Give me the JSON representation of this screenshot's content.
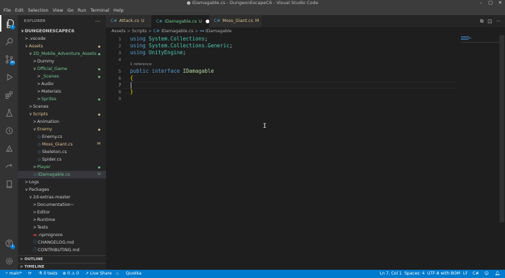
{
  "window": {
    "title": "● IDamagable.cs - DungeonEscapeC6 - Visual Studio Code",
    "menu": [
      "File",
      "Edit",
      "Selection",
      "View",
      "Go",
      "Run",
      "Terminal",
      "Help"
    ],
    "controls": {
      "minimize": "–",
      "maximize": "▢",
      "close": "✕"
    }
  },
  "activity_bar": {
    "items": [
      {
        "name": "explorer-icon",
        "badge": "1"
      },
      {
        "name": "search-icon"
      },
      {
        "name": "source-control-icon",
        "badge": "40"
      },
      {
        "name": "run-debug-icon"
      },
      {
        "name": "extensions-icon"
      },
      {
        "name": "testing-icon"
      },
      {
        "name": "timeline-icon"
      },
      {
        "name": "azure-icon"
      },
      {
        "name": "live-share-icon"
      },
      {
        "name": "notebook-icon"
      }
    ],
    "bottom": [
      {
        "name": "accounts-icon",
        "badge": "1"
      },
      {
        "name": "manage-gear-icon"
      }
    ]
  },
  "sidebar": {
    "title": "EXPLORER",
    "more": "···",
    "tree": [
      {
        "label": "DUNGEONESCAPEC6",
        "chevron": "∨",
        "indent": 0,
        "type": "root"
      },
      {
        "label": ".vscode",
        "chevron": ">",
        "indent": 1
      },
      {
        "label": "Assets",
        "chevron": "∨",
        "indent": 1,
        "status": "dot",
        "color": "modified"
      },
      {
        "label": "2D_Mobile_Adventure_Assets",
        "chevron": "∨",
        "indent": 2,
        "status": "dot",
        "color": "untracked"
      },
      {
        "label": "Dummy",
        "chevron": ">",
        "indent": 3
      },
      {
        "label": "Official_Game",
        "chevron": "∨",
        "indent": 3,
        "status": "dot",
        "color": "untracked"
      },
      {
        "label": "_Scenes",
        "chevron": ">",
        "indent": 4,
        "status": "dot",
        "color": "untracked"
      },
      {
        "label": "Audio",
        "chevron": ">",
        "indent": 4
      },
      {
        "label": "Materials",
        "chevron": ">",
        "indent": 4
      },
      {
        "label": "Sprites",
        "chevron": ">",
        "indent": 4,
        "status": "dot",
        "color": "untracked"
      },
      {
        "label": "Scenes",
        "chevron": ">",
        "indent": 2
      },
      {
        "label": "Scripts",
        "chevron": "∨",
        "indent": 2,
        "status": "dot",
        "color": "modified"
      },
      {
        "label": "Animation",
        "chevron": ">",
        "indent": 3
      },
      {
        "label": "Enemy",
        "chevron": "∨",
        "indent": 3,
        "status": "dot",
        "color": "modified"
      },
      {
        "label": "Enemy.cs",
        "file": "C#",
        "indent": 4
      },
      {
        "label": "Moss_Giant.cs",
        "file": "C#",
        "indent": 4,
        "status": "M",
        "color": "modified"
      },
      {
        "label": "Skeleton.cs",
        "file": "C#",
        "indent": 4
      },
      {
        "label": "Spider.cs",
        "file": "C#",
        "indent": 4
      },
      {
        "label": "Player",
        "chevron": ">",
        "indent": 3,
        "status": "dot",
        "color": "untracked"
      },
      {
        "label": "IDamagable.cs",
        "file": "C#",
        "indent": 3,
        "status": "U",
        "color": "untracked",
        "selected": true
      },
      {
        "label": "Logs",
        "chevron": ">",
        "indent": 1
      },
      {
        "label": "Packages",
        "chevron": "∨",
        "indent": 1
      },
      {
        "label": "2d-extras-master",
        "chevron": "∨",
        "indent": 2
      },
      {
        "label": "Documentation~",
        "chevron": ">",
        "indent": 3
      },
      {
        "label": "Editor",
        "chevron": ">",
        "indent": 3
      },
      {
        "label": "Runtime",
        "chevron": ">",
        "indent": 3
      },
      {
        "label": "Tests",
        "chevron": ">",
        "indent": 3
      },
      {
        "label": ".npmignore",
        "file": "npm",
        "indent": 3
      },
      {
        "label": "CHANGELOG.md",
        "file": "info",
        "indent": 3
      },
      {
        "label": "CONTRIBUTING.md",
        "file": "info",
        "indent": 3
      }
    ],
    "sections": [
      {
        "label": "OUTLINE",
        "chevron": ">"
      },
      {
        "label": "TIMELINE",
        "chevron": ">"
      }
    ]
  },
  "tabs": [
    {
      "label": "Attack.cs",
      "status": "U",
      "active": false,
      "dirty": false
    },
    {
      "label": "IDamagable.cs",
      "status": "U",
      "active": true,
      "dirty": true
    },
    {
      "label": "Moss_Giant.cs",
      "status": "M",
      "active": false,
      "dirty": false
    }
  ],
  "editor_actions": [
    "split-compare-icon",
    "split-editor-icon",
    "more-actions-icon"
  ],
  "breadcrumbs": [
    "Assets",
    "Scripts",
    "IDamagable.cs",
    "IDamagable"
  ],
  "editor": {
    "codelens": "1 reference",
    "lines": [
      {
        "n": "1",
        "tokens": [
          {
            "t": "using ",
            "c": "kw"
          },
          {
            "t": "System.Collections",
            "c": "ns"
          },
          {
            "t": ";",
            "c": "punct"
          }
        ]
      },
      {
        "n": "2",
        "tokens": [
          {
            "t": "using ",
            "c": "kw"
          },
          {
            "t": "System.Collections.Generic",
            "c": "ns"
          },
          {
            "t": ";",
            "c": "punct"
          }
        ]
      },
      {
        "n": "3",
        "tokens": [
          {
            "t": "using ",
            "c": "kw"
          },
          {
            "t": "UnityEngine",
            "c": "ns"
          },
          {
            "t": ";",
            "c": "punct"
          }
        ]
      },
      {
        "n": "4",
        "tokens": []
      },
      {
        "n": "5",
        "tokens": [
          {
            "t": "public ",
            "c": "kw"
          },
          {
            "t": "interface ",
            "c": "kw"
          },
          {
            "t": "IDamagable",
            "c": "typename"
          }
        ]
      },
      {
        "n": "6",
        "tokens": [
          {
            "t": "{",
            "c": "brace"
          }
        ]
      },
      {
        "n": "7",
        "tokens": []
      },
      {
        "n": "8",
        "tokens": [
          {
            "t": "}",
            "c": "brace"
          }
        ]
      },
      {
        "n": "9",
        "tokens": []
      }
    ],
    "current_line": 7
  },
  "statusbar": {
    "branch": "main*",
    "sync": "sync-icon",
    "tests": "0 tests",
    "errors": "0",
    "warnings": "0",
    "live_share": "Live Share",
    "quokka": "Quokka",
    "position": "Ln 7, Col 1",
    "spaces": "Spaces: 4",
    "encoding": "UTF-8 with BOM",
    "eol": "LF",
    "language": "C#"
  }
}
